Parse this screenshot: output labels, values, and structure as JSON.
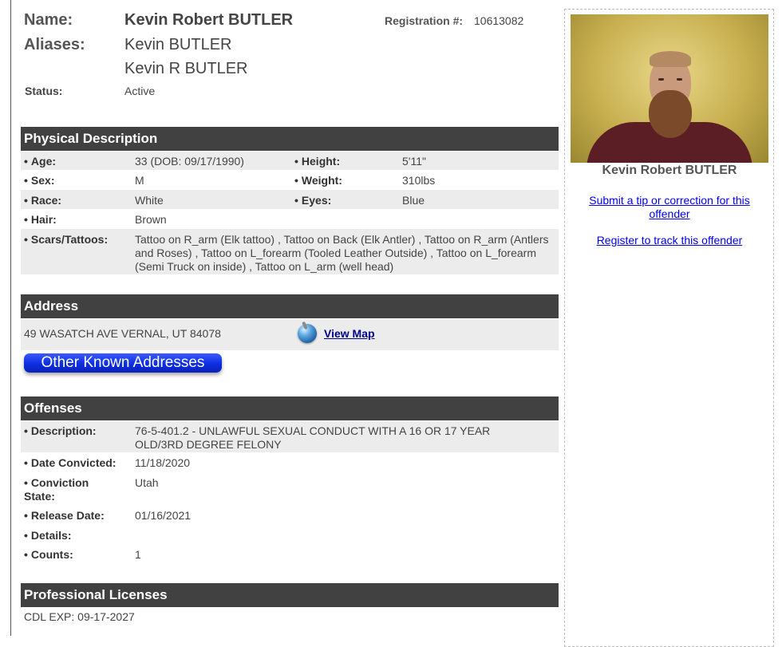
{
  "header": {
    "name_label": "Name:",
    "name": "Kevin Robert BUTLER",
    "reg_label": "Registration #:",
    "reg_number": "10613082",
    "aliases_label": "Aliases:",
    "aliases": [
      "Kevin BUTLER",
      "Kevin R BUTLER"
    ],
    "status_label": "Status:",
    "status": "Active"
  },
  "physical": {
    "title": "Physical Description",
    "age_label": "Age:",
    "age": "33  (DOB: 09/17/1990)",
    "height_label": "Height:",
    "height": "5'11\"",
    "sex_label": "Sex:",
    "sex": "M",
    "weight_label": "Weight:",
    "weight": "310lbs",
    "race_label": "Race:",
    "race": "White",
    "eyes_label": "Eyes:",
    "eyes": "Blue",
    "hair_label": "Hair:",
    "hair": "Brown",
    "scars_label": "Scars/Tattoos:",
    "scars": "Tattoo on R_arm (Elk tattoo) , Tattoo on Back (Elk Antler) , Tattoo on R_arm (Antlers and Roses) , Tattoo on L_forearm (Tooled Leather Outside) , Tattoo on L_forearm (Semi Truck on inside) , Tattoo on L_arm (well head)"
  },
  "address": {
    "title": "Address",
    "line": "49 WASATCH AVE VERNAL, UT 84078",
    "map_link": "View Map",
    "other_button": "Other Known Addresses"
  },
  "offenses": {
    "title": "Offenses",
    "description_label": "Description:",
    "description": "76-5-401.2 - UNLAWFUL SEXUAL CONDUCT WITH A 16 OR 17 YEAR OLD/3RD DEGREE FELONY",
    "date_convicted_label": "Date Convicted:",
    "date_convicted": "11/18/2020",
    "conviction_state_label": "Conviction State:",
    "conviction_state": "Utah",
    "release_date_label": "Release Date:",
    "release_date": "01/16/2021",
    "details_label": "Details:",
    "details": "",
    "counts_label": "Counts:",
    "counts": "1"
  },
  "licenses": {
    "title": "Professional Licenses",
    "line": "CDL EXP: 09-17-2027"
  },
  "sidebar": {
    "photo_caption": "Kevin Robert BUTLER",
    "tip_link": "Submit a tip or correction for this offender",
    "register_link": "Register to track this offender"
  },
  "bullet_char": "•"
}
